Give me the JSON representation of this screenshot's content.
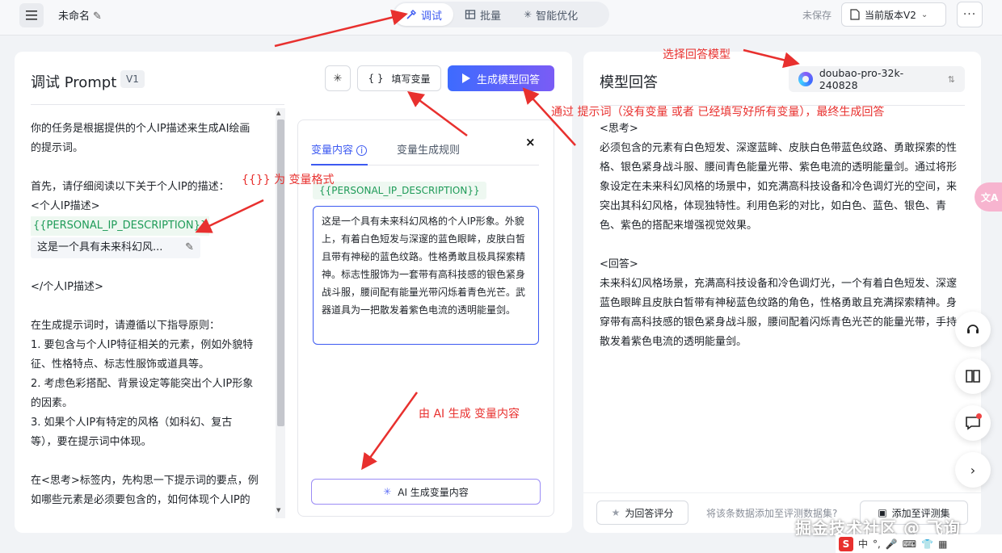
{
  "topbar": {
    "doc_title": "未命名",
    "tabs": [
      {
        "label": "调试",
        "icon": "debug-icon"
      },
      {
        "label": "批量",
        "icon": "table-icon"
      },
      {
        "label": "智能优化",
        "icon": "sparkle-icon"
      }
    ],
    "unsaved": "未保存",
    "version": "当前版本V2"
  },
  "left": {
    "title": "调试 Prompt",
    "version_badge": "V1",
    "fill_label": "填写变量",
    "generate_label": "生成模型回答",
    "prompt": {
      "l1": "你的任务是根据提供的个人IP描述来生成AI绘画",
      "l2": "的提示词。",
      "l3": "首先，请仔细阅读以下关于个人IP的描述：",
      "l4": "<个人IP描述>",
      "var": "{{PERSONAL_IP_DESCRIPTION}}",
      "var_preview": "这是一个具有未来科幻风...",
      "l5": "</个人IP描述>",
      "l6": "在生成提示词时，请遵循以下指导原则：",
      "l7": "1. 要包含与个人IP特征相关的元素，例如外貌特",
      "l8": "征、性格特点、标志性服饰或道具等。",
      "l9": "2. 考虑色彩搭配、背景设定等能突出个人IP形象",
      "l10": "的因素。",
      "l11": "3. 如果个人IP有特定的风格（如科幻、复古",
      "l12": "等），要在提示词中体现。",
      "l13": "在<思考>标签内，先构思一下提示词的要点，例",
      "l14": "如哪些元素是必须要包含的，如何体现个人IP的"
    },
    "var_panel": {
      "tab_content": "变量内容",
      "tab_rules": "变量生成规则",
      "close": "×",
      "var_name": "{{PERSONAL_IP_DESCRIPTION}}",
      "var_value": "这是一个具有未来科幻风格的个人IP形象。外貌上，有着白色短发与深邃的蓝色眼眸，皮肤白皙且带有神秘的蓝色纹路。性格勇敢且极具探索精神。标志性服饰为一套带有高科技感的银色紧身战斗服，腰间配有能量光带闪烁着青色光芒。武器道具为一把散发着紫色电流的透明能量剑。",
      "ai_gen_label": "AI 生成变量内容"
    }
  },
  "right": {
    "title": "模型回答",
    "model": "doubao-pro-32k-240828",
    "answer": {
      "think_tag": "<思考>",
      "think_body": "必须包含的元素有白色短发、深邃蓝眸、皮肤白色带蓝色纹路、勇敢探索的性格、银色紧身战斗服、腰间青色能量光带、紫色电流的透明能量剑。通过将形象设定在未来科幻风格的场景中，如充满高科技设备和冷色调灯光的空间，来突出其科幻风格，体现独特性。利用色彩的对比，如白色、蓝色、银色、青色、紫色的搭配来增强视觉效果。",
      "answer_tag": "<回答>",
      "answer_body": "未来科幻风格场景，充满高科技设备和冷色调灯光，一个有着白色短发、深邃蓝色眼眸且皮肤白皙带有神秘蓝色纹路的角色，性格勇敢且充满探索精神。身穿带有高科技感的银色紧身战斗服，腰间配着闪烁青色光芒的能量光带，手持散发着紫色电流的透明能量剑。"
    },
    "rate_label": "为回答评分",
    "add_hint": "将该条数据添加至评测数据集?",
    "add_eval_label": "添加至评测集"
  },
  "annotations": {
    "choose_model": "选择回答模型",
    "generate_note": "通过 提示词（没有变量 或者 已经填写好所有变量），最终生成回答",
    "var_format": "{{}} 为 变量格式",
    "ai_note": "由 AI 生成 变量内容"
  },
  "watermark": "掘金技术社区 @ 飞询",
  "ime": {
    "lang": "中",
    "dot": "°,"
  },
  "colors": {
    "accent": "#3d5af1",
    "var_green": "#1e9b58",
    "annotation_red": "#e8302e"
  }
}
